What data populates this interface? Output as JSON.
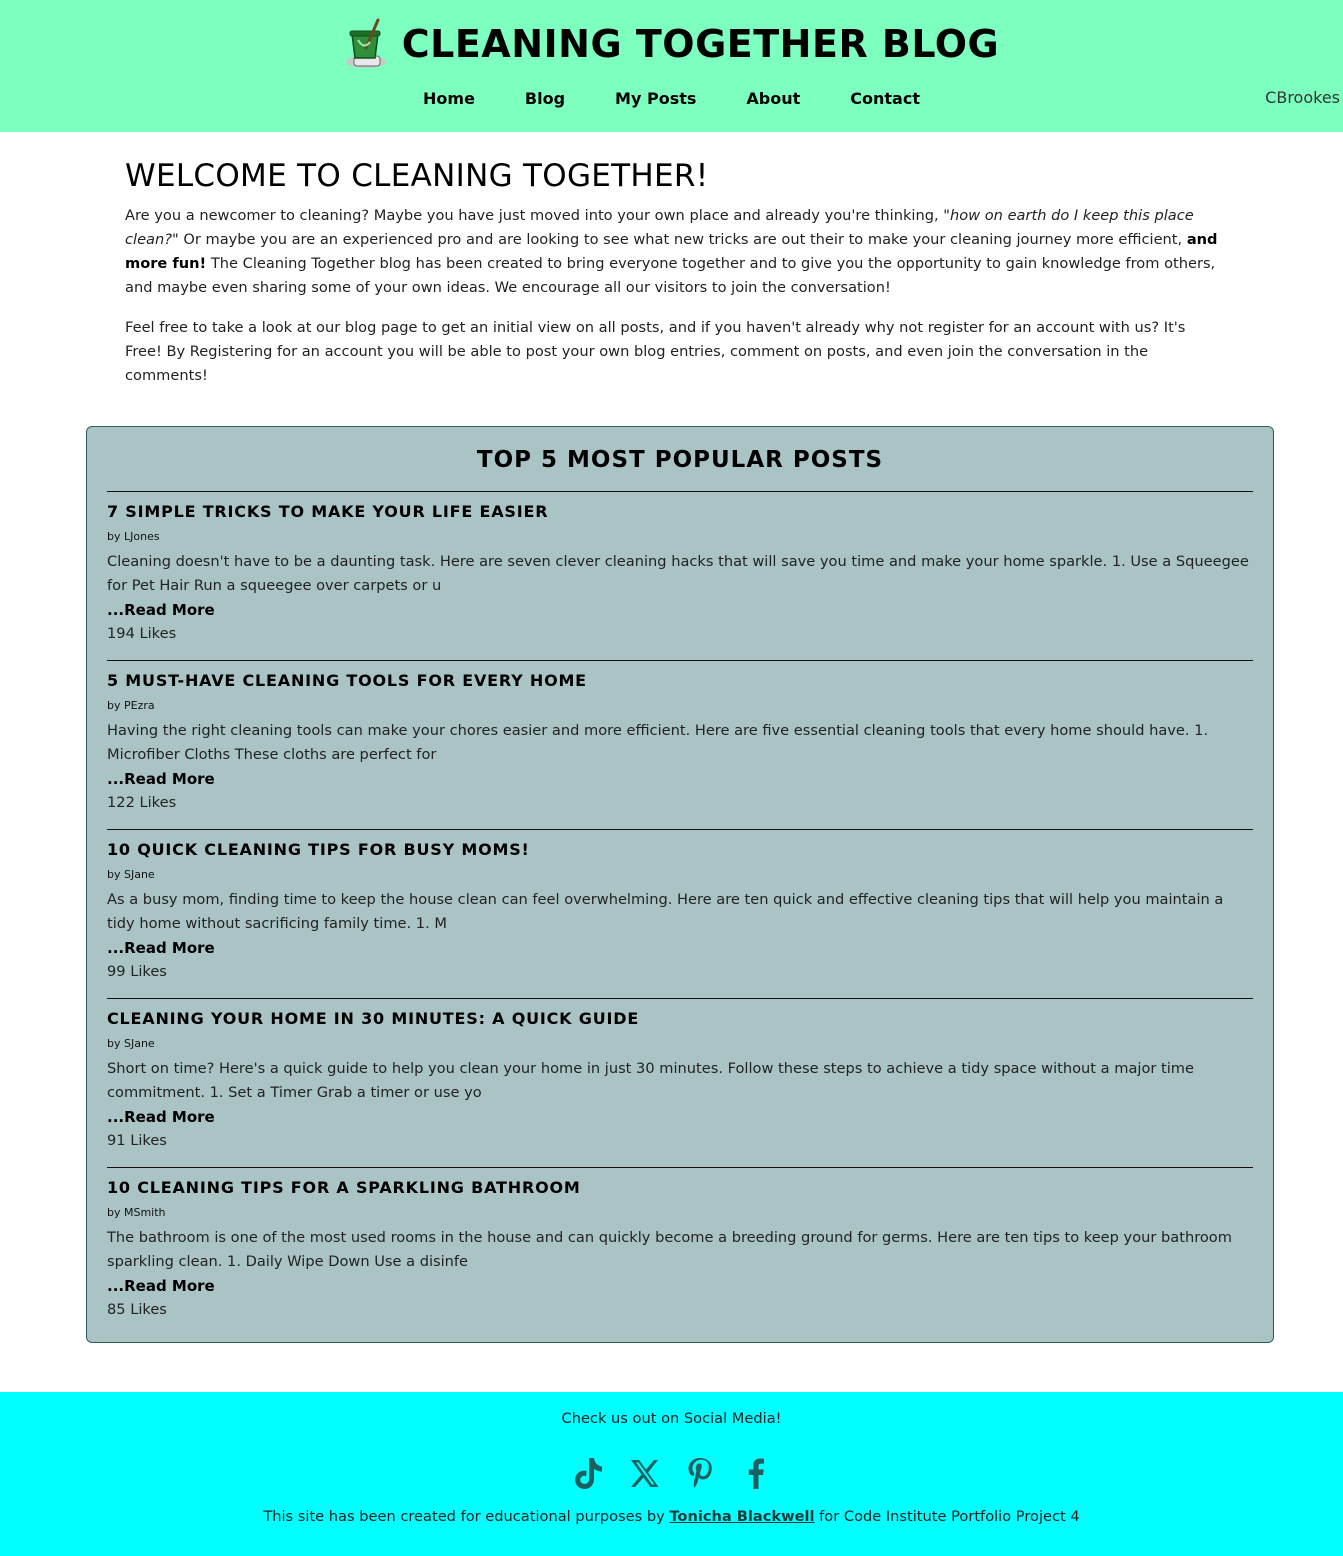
{
  "header": {
    "title": "CLEANING TOGETHER BLOG",
    "logo_icon": "mop-bucket-icon",
    "nav": [
      {
        "label": "Home"
      },
      {
        "label": "Blog"
      },
      {
        "label": "My Posts"
      },
      {
        "label": "About"
      },
      {
        "label": "Contact"
      }
    ],
    "username": "CBrookes"
  },
  "welcome": {
    "heading": "WELCOME TO CLEANING TOGETHER!",
    "p1_a": "Are you a newcomer to cleaning? Maybe you have just moved into your own place and already you're thinking, ",
    "p1_em": "\"how on earth do I keep this place clean?\"",
    "p1_b": " Or maybe you are an experienced pro and are looking to see what new tricks are out their to make your cleaning journey more efficient, ",
    "p1_strong": "and more fun!",
    "p1_c": " The Cleaning Together blog has been created to bring everyone together and to give you the opportunity to gain knowledge from others, and maybe even sharing some of your own ideas. We encourage all our visitors to join the conversation!",
    "p2": "Feel free to take a look at our blog page to get an initial view on all posts, and if you haven't already why not register for an account with us? It's Free! By Registering for an account you will be able to post your own blog entries, comment on posts, and even join the conversation in the comments!"
  },
  "popular": {
    "heading": "TOP 5 MOST POPULAR POSTS",
    "posts": [
      {
        "title": "7 SIMPLE TRICKS TO MAKE YOUR LIFE EASIER",
        "author": "by LJones",
        "excerpt": "Cleaning doesn't have to be a daunting task. Here are seven clever cleaning hacks that will save you time and make your home sparkle. 1. Use a Squeegee for Pet Hair Run a squeegee over carpets or u",
        "read_more": "...Read More",
        "likes": "194 Likes"
      },
      {
        "title": "5 MUST-HAVE CLEANING TOOLS FOR EVERY HOME",
        "author": "by PEzra",
        "excerpt": "Having the right cleaning tools can make your chores easier and more efficient. Here are five essential cleaning tools that every home should have. 1. Microfiber Cloths These cloths are perfect for",
        "read_more": "...Read More",
        "likes": "122 Likes"
      },
      {
        "title": "10 QUICK CLEANING TIPS FOR BUSY MOMS!",
        "author": "by SJane",
        "excerpt": "As a busy mom, finding time to keep the house clean can feel overwhelming. Here are ten quick and effective cleaning tips that will help you maintain a tidy home without sacrificing family time. 1. M",
        "read_more": "...Read More",
        "likes": "99 Likes"
      },
      {
        "title": "CLEANING YOUR HOME IN 30 MINUTES: A QUICK GUIDE",
        "author": "by SJane",
        "excerpt": "Short on time? Here's a quick guide to help you clean your home in just 30 minutes. Follow these steps to achieve a tidy space without a major time commitment. 1. Set a Timer Grab a timer or use yo",
        "read_more": "...Read More",
        "likes": "91 Likes"
      },
      {
        "title": "10 CLEANING TIPS FOR A SPARKLING BATHROOM",
        "author": "by MSmith",
        "excerpt": "The bathroom is one of the most used rooms in the house and can quickly become a breeding ground for germs. Here are ten tips to keep your bathroom sparkling clean. 1. Daily Wipe Down Use a disinfe",
        "read_more": "...Read More",
        "likes": "85 Likes"
      }
    ]
  },
  "footer": {
    "social_text": "Check us out on Social Media!",
    "social_icons": [
      "tiktok-icon",
      "x-icon",
      "pinterest-icon",
      "facebook-icon"
    ],
    "credit_a": "This site has been created for educational purposes by ",
    "credit_link": "Tonicha Blackwell",
    "credit_b": " for Code Institute Portfolio Project 4"
  },
  "colors": {
    "header_bg": "#7dffc0",
    "posts_box_bg": "#aac4c5",
    "footer_bg": "#00ffff",
    "social_icon": "#1f5f5f"
  }
}
